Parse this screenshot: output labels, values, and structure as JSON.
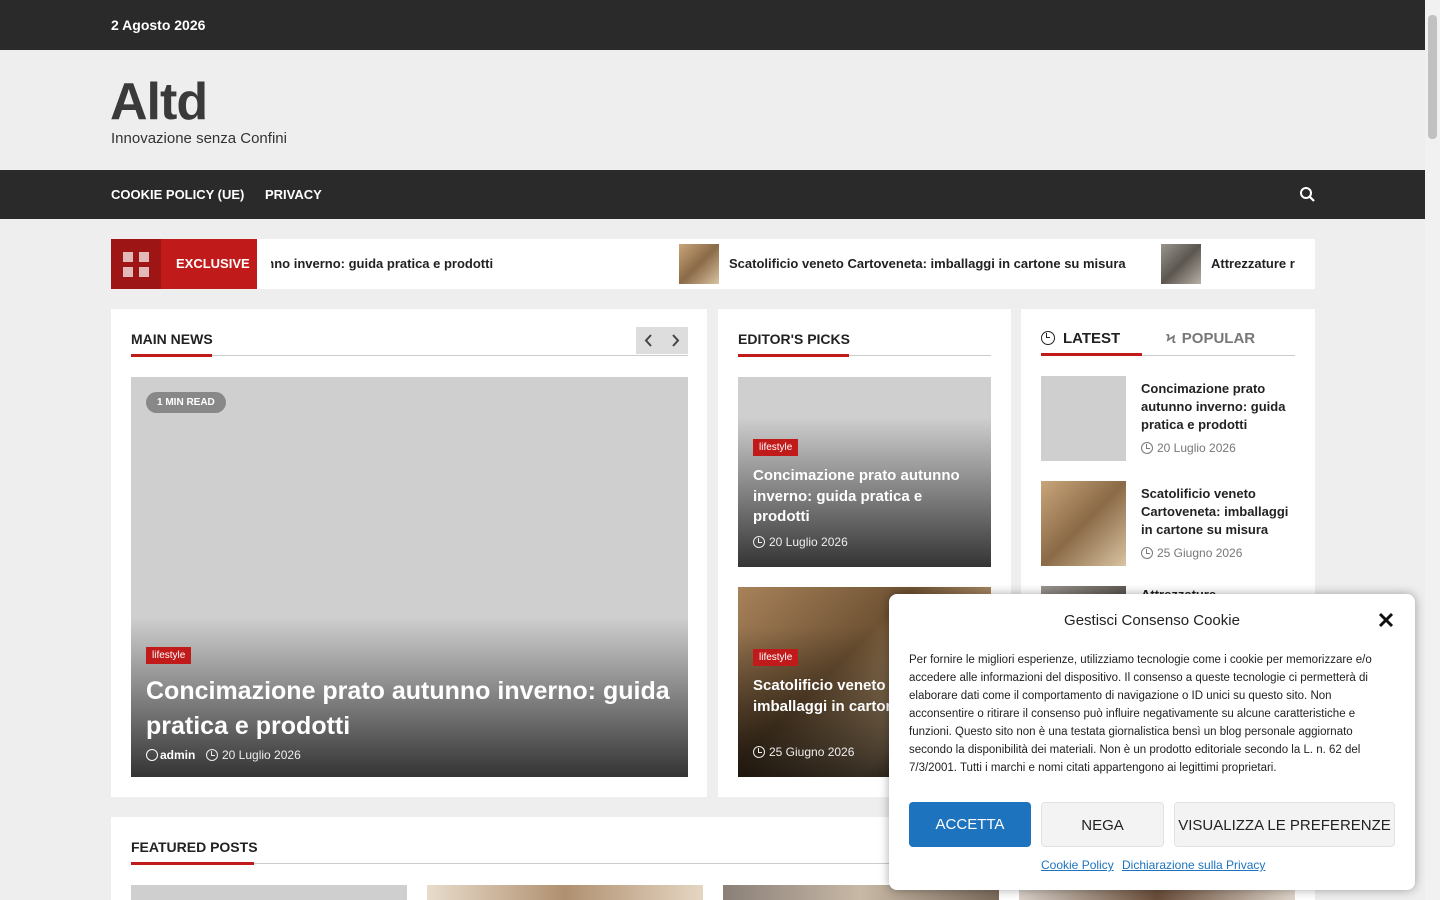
{
  "topbar": {
    "date": "2 Agosto 2026"
  },
  "site": {
    "title": "Altd",
    "tagline": "Innovazione senza Confini"
  },
  "nav": {
    "items": [
      "COOKIE POLICY (UE)",
      "PRIVACY"
    ]
  },
  "ticker": {
    "label": "EXCLUSIVE",
    "items": [
      "Concimazione prato autunno inverno: guida pratica e prodotti",
      "Scatolificio veneto Cartoveneta: imballaggi in cartone su misura",
      "Attrezzature r"
    ]
  },
  "main_news": {
    "title": "MAIN NEWS",
    "read_time": "1 MIN READ",
    "category": "lifestyle",
    "headline": "Concimazione prato autunno inverno: guida pratica e prodotti",
    "author": "admin",
    "date": "20 Luglio 2026"
  },
  "editors_picks": {
    "title": "EDITOR'S PICKS",
    "items": [
      {
        "category": "lifestyle",
        "headline": "Concimazione prato autunno inverno: guida pratica e prodotti",
        "date": "20 Luglio 2026"
      },
      {
        "category": "lifestyle",
        "headline": "Scatolificio veneto Cartoveneta: imballaggi in cartone su misura",
        "date": "25 Giugno 2026"
      }
    ]
  },
  "sidebar": {
    "tabs": [
      "LATEST",
      "POPULAR"
    ],
    "items": [
      {
        "title": "Concimazione prato autunno inverno: guida pratica e prodotti",
        "date": "20 Luglio 2026"
      },
      {
        "title": "Scatolificio veneto Cartoveneta: imballaggi in cartone su misura",
        "date": "25 Giugno 2026"
      },
      {
        "title": "Attrezzature"
      }
    ]
  },
  "featured": {
    "title": "FEATURED POSTS"
  },
  "cookie": {
    "title": "Gestisci Consenso Cookie",
    "body": "Per fornire le migliori esperienze, utilizziamo tecnologie come i cookie per memorizzare e/o accedere alle informazioni del dispositivo. Il consenso a queste tecnologie ci permetterà di elaborare dati come il comportamento di navigazione o ID unici su questo sito. Non acconsentire o ritirare il consenso può influire negativamente su alcune caratteristiche e funzioni. Questo sito non è una testata giornalistica bensì un blog personale aggiornato secondo la disponibilità dei materiali. Non è un prodotto editoriale secondo la L. n. 62 del 7/3/2001. Tutti i marchi e nomi citati appartengono ai legittimi proprietari.",
    "accept": "ACCETTA",
    "deny": "NEGA",
    "preferences": "VISUALIZZA LE PREFERENZE",
    "links": [
      "Cookie Policy",
      "Dichiarazione sulla Privacy"
    ]
  },
  "colors": {
    "accent": "#c11a1a",
    "dark": "#2a2a2a",
    "button": "#1e73be"
  }
}
